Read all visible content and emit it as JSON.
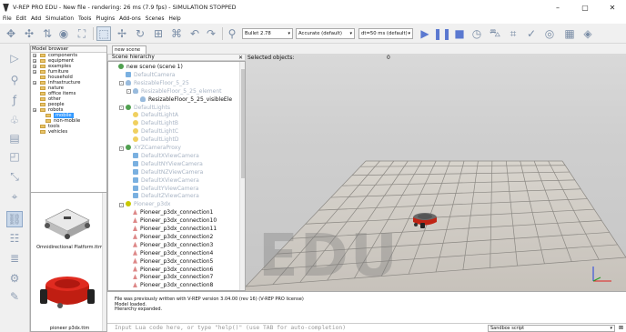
{
  "window": {
    "title": "V-REP PRO EDU - New file - rendering: 26 ms (7.9 fps) - SIMULATION STOPPED",
    "controls": {
      "minimize": "–",
      "maximize": "▢",
      "close": "✕"
    }
  },
  "menu": [
    "File",
    "Edit",
    "Add",
    "Simulation",
    "Tools",
    "Plugins",
    "Add-ons",
    "Scenes",
    "Help"
  ],
  "toolbar": {
    "physics_engine": "Bullet 2.78",
    "accuracy": "Accurate (default)",
    "timestep": "dt=50 ms (default)"
  },
  "model_browser": {
    "title": "Model browser",
    "items": [
      {
        "label": "components",
        "expandable": true,
        "indent": 0
      },
      {
        "label": "equipment",
        "expandable": true,
        "indent": 0
      },
      {
        "label": "examples",
        "expandable": true,
        "indent": 0
      },
      {
        "label": "furniture",
        "expandable": true,
        "indent": 0
      },
      {
        "label": "household",
        "expandable": false,
        "indent": 0
      },
      {
        "label": "infrastructure",
        "expandable": true,
        "indent": 0
      },
      {
        "label": "nature",
        "expandable": false,
        "indent": 0
      },
      {
        "label": "office items",
        "expandable": false,
        "indent": 0
      },
      {
        "label": "other",
        "expandable": false,
        "indent": 0
      },
      {
        "label": "people",
        "expandable": false,
        "indent": 0
      },
      {
        "label": "robots",
        "expandable": true,
        "indent": 0
      },
      {
        "label": "mobile",
        "expandable": false,
        "indent": 1,
        "selected": true
      },
      {
        "label": "non-mobile",
        "expandable": false,
        "indent": 1
      },
      {
        "label": "tools",
        "expandable": false,
        "indent": 0
      },
      {
        "label": "vehicles",
        "expandable": false,
        "indent": 0
      }
    ],
    "thumbnails": [
      "Omnidirectional Platform.ttm",
      "pioneer p3dx.ttm"
    ]
  },
  "scene_tab": "new scene",
  "hierarchy": {
    "title": "Scene hierarchy",
    "close": "✕",
    "rows": [
      {
        "label": "new scene (scene 1)",
        "icon": "scene",
        "level": 0,
        "dim": false
      },
      {
        "label": "DefaultCamera",
        "icon": "cam",
        "level": 1,
        "dim": true
      },
      {
        "label": "ResizableFloor_5_25",
        "icon": "shape",
        "level": 1,
        "dim": true,
        "exp": "-"
      },
      {
        "label": "ResizableFloor_5_25_element",
        "icon": "shape",
        "level": 2,
        "dim": true,
        "exp": "-"
      },
      {
        "label": "ResizableFloor_5_25_visibleEle",
        "icon": "shape",
        "level": 3,
        "dim": false
      },
      {
        "label": "DefaultLights",
        "icon": "dummy",
        "level": 1,
        "dim": true,
        "exp": "-"
      },
      {
        "label": "DefaultLightA",
        "icon": "light",
        "level": 2,
        "dim": true
      },
      {
        "label": "DefaultLightB",
        "icon": "light",
        "level": 2,
        "dim": true
      },
      {
        "label": "DefaultLightC",
        "icon": "light",
        "level": 2,
        "dim": true
      },
      {
        "label": "DefaultLightD",
        "icon": "light",
        "level": 2,
        "dim": true
      },
      {
        "label": "XYZCameraProxy",
        "icon": "dummy",
        "level": 1,
        "dim": true,
        "exp": "-"
      },
      {
        "label": "DefaultXViewCamera",
        "icon": "cam",
        "level": 2,
        "dim": true
      },
      {
        "label": "DefaultNYViewCamera",
        "icon": "cam",
        "level": 2,
        "dim": true
      },
      {
        "label": "DefaultNZViewCamera",
        "icon": "cam",
        "level": 2,
        "dim": true
      },
      {
        "label": "DefaultXViewCamera",
        "icon": "cam",
        "level": 2,
        "dim": true
      },
      {
        "label": "DefaultYViewCamera",
        "icon": "cam",
        "level": 2,
        "dim": true
      },
      {
        "label": "DefaultZViewCamera",
        "icon": "cam",
        "level": 2,
        "dim": true
      },
      {
        "label": "Pioneer_p3dx",
        "icon": "robot",
        "level": 1,
        "dim": true,
        "exp": "-"
      },
      {
        "label": "Pioneer_p3dx_connection1",
        "icon": "conn",
        "level": 2,
        "dim": false
      },
      {
        "label": "Pioneer_p3dx_connection10",
        "icon": "conn",
        "level": 2,
        "dim": false
      },
      {
        "label": "Pioneer_p3dx_connection11",
        "icon": "conn",
        "level": 2,
        "dim": false
      },
      {
        "label": "Pioneer_p3dx_connection2",
        "icon": "conn",
        "level": 2,
        "dim": false
      },
      {
        "label": "Pioneer_p3dx_connection3",
        "icon": "conn",
        "level": 2,
        "dim": false
      },
      {
        "label": "Pioneer_p3dx_connection4",
        "icon": "conn",
        "level": 2,
        "dim": false
      },
      {
        "label": "Pioneer_p3dx_connection5",
        "icon": "conn",
        "level": 2,
        "dim": false
      },
      {
        "label": "Pioneer_p3dx_connection6",
        "icon": "conn",
        "level": 2,
        "dim": false
      },
      {
        "label": "Pioneer_p3dx_connection7",
        "icon": "conn",
        "level": 2,
        "dim": false
      },
      {
        "label": "Pioneer_p3dx_connection8",
        "icon": "conn",
        "level": 2,
        "dim": false
      }
    ]
  },
  "viewport": {
    "selected_label": "Selected objects:",
    "selected_count": "0",
    "watermark": "EDU"
  },
  "console": {
    "lines": [
      "File was previously written with V-REP version 3.04.00 (rev 16) (V-REP PRO license)",
      "Model loaded.",
      "Hierarchy expanded."
    ]
  },
  "lua": {
    "placeholder": "Input Lua code here, or type \"help()\" (use TAB for auto-completion)",
    "script_select": "Sandbox script",
    "close": "⊠"
  }
}
